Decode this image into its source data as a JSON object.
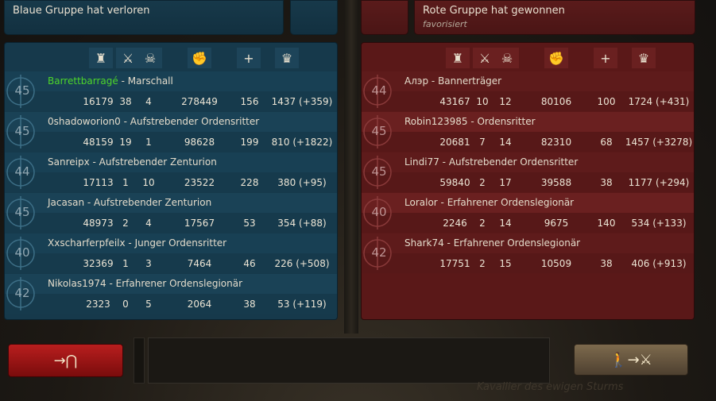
{
  "blue_header": {
    "title": "Blaue Gruppe hat verloren"
  },
  "red_header": {
    "title": "Rote Gruppe hat gewonnen",
    "subtitle": "favorisiert"
  },
  "column_icons": [
    "tower-icon",
    "crossed-swords-icon",
    "skull-icon",
    "fist-icon",
    "plus-icon",
    "crown-icon"
  ],
  "icon_glyphs": [
    "♜",
    "⚔",
    "☠",
    "✊",
    "+",
    "♛"
  ],
  "colors": {
    "blue_panel": "#16394b",
    "red_panel": "#5a1818",
    "highlight_name": "#4dd62a",
    "leave_button": "#b81e1e",
    "fight_button": "#6b5a40"
  },
  "blue_team": [
    {
      "level": "45",
      "name": "Barrettbarragé",
      "title": "Marschall",
      "highlight": true,
      "stats": [
        "16179",
        "38",
        "4",
        "278449",
        "156",
        "1437 (+359)"
      ]
    },
    {
      "level": "45",
      "name": "0shadoworion0",
      "title": "Aufstrebender Ordensritter",
      "stats": [
        "48159",
        "19",
        "1",
        "98628",
        "199",
        "810 (+1822)"
      ]
    },
    {
      "level": "44",
      "name": "Sanreipx",
      "title": "Aufstrebender Zenturion",
      "stats": [
        "17113",
        "1",
        "10",
        "23522",
        "228",
        "380 (+95)"
      ]
    },
    {
      "level": "45",
      "name": "Jacasan",
      "title": "Aufstrebender Zenturion",
      "stats": [
        "48973",
        "2",
        "4",
        "17567",
        "53",
        "354 (+88)"
      ]
    },
    {
      "level": "40",
      "name": "Xxscharferpfeilx",
      "title": "Junger Ordensritter",
      "stats": [
        "32369",
        "1",
        "3",
        "7464",
        "46",
        "226 (+508)"
      ]
    },
    {
      "level": "42",
      "name": "Nikolas1974",
      "title": "Erfahrener Ordenslegionär",
      "stats": [
        "2323",
        "0",
        "5",
        "2064",
        "38",
        "53 (+119)"
      ]
    }
  ],
  "red_team": [
    {
      "level": "44",
      "name": "Алэр",
      "title": "Bannerträger",
      "stats": [
        "43167",
        "10",
        "12",
        "80106",
        "100",
        "1724 (+431)"
      ]
    },
    {
      "level": "45",
      "name": "Robin123985",
      "title": "Ordensritter",
      "stats": [
        "20681",
        "7",
        "14",
        "82310",
        "68",
        "1457 (+3278)"
      ]
    },
    {
      "level": "45",
      "name": "Lindi77",
      "title": "Aufstrebender Ordensritter",
      "stats": [
        "59840",
        "2",
        "17",
        "39588",
        "38",
        "1177 (+294)"
      ]
    },
    {
      "level": "40",
      "name": "Loralor",
      "title": "Erfahrener Ordenslegionär",
      "stats": [
        "2246",
        "2",
        "14",
        "9675",
        "140",
        "534 (+133)"
      ]
    },
    {
      "level": "42",
      "name": "Shark74",
      "title": "Erfahrener Ordenslegionär",
      "stats": [
        "17751",
        "2",
        "15",
        "10509",
        "38",
        "406 (+913)"
      ]
    }
  ],
  "buttons": {
    "leave_glyph": "→⋂",
    "fight_glyph": "🚶→⚔"
  },
  "watermark": "Kavallier des ewigen Sturms"
}
